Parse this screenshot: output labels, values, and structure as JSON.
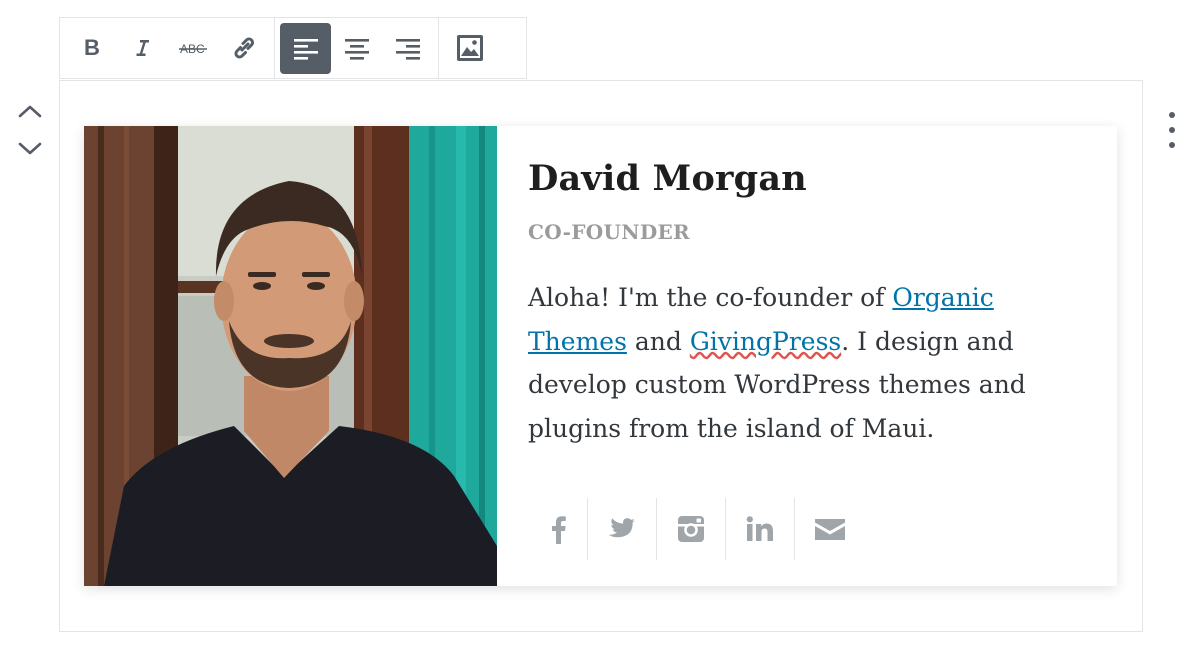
{
  "toolbar": {
    "groups": [
      {
        "name": "formatting",
        "buttons": [
          "bold-icon",
          "italic-icon",
          "strikethrough-icon",
          "link-icon"
        ]
      },
      {
        "name": "alignment",
        "buttons": [
          "align-left-icon",
          "align-center-icon",
          "align-right-icon"
        ],
        "active": "align-left-icon"
      },
      {
        "name": "media",
        "buttons": [
          "image-icon"
        ]
      }
    ]
  },
  "profile": {
    "name": "David Morgan",
    "title": "CO-FOUNDER",
    "bio": {
      "part1": "Aloha! I'm the co-founder of ",
      "link1": "Organic Themes",
      "part2": " and ",
      "link2": "GivingPress",
      "part3": ". I design and develop custom WordPress themes and plugins from the island of Maui."
    },
    "social": [
      "facebook-icon",
      "twitter-icon",
      "instagram-icon",
      "linkedin-icon",
      "email-icon"
    ]
  },
  "colors": {
    "link": "#0073aa",
    "icon": "#555d66",
    "social_icon": "#a0a5aa",
    "active_button_bg": "#555d66"
  }
}
